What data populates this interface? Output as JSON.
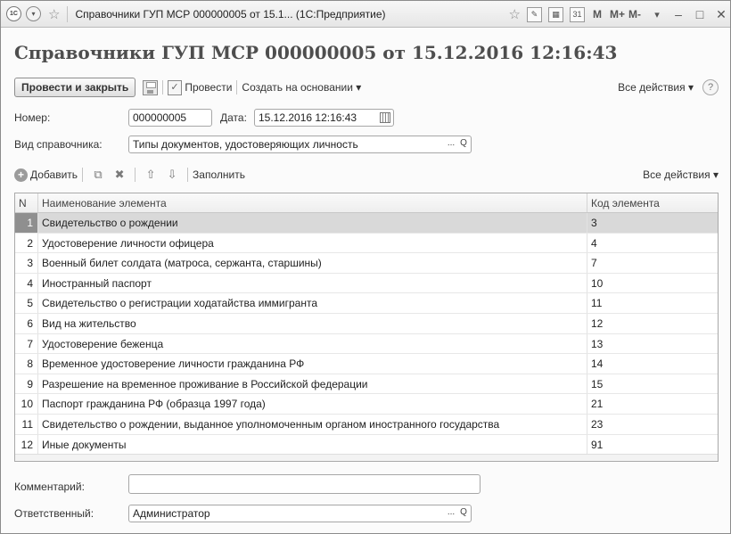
{
  "window": {
    "title": "Справочники ГУП МСР 000000005 от 15.1... (1С:Предприятие)",
    "logo_text": "1С",
    "title_right": {
      "m": "M",
      "m_plus": "M+",
      "m_minus": "M-"
    }
  },
  "doc": {
    "title": "Справочники ГУП МСР 000000005 от 15.12.2016 12:16:43"
  },
  "commands": {
    "post_close": "Провести и закрыть",
    "post": "Провести",
    "create_based": "Создать на основании ▾",
    "all_actions": "Все действия ▾",
    "help": "?"
  },
  "form": {
    "number_label": "Номер:",
    "number_value": "000000005",
    "date_label": "Дата:",
    "date_value": "15.12.2016 12:16:43",
    "kind_label": "Вид справочника:",
    "kind_value": "Типы документов, удостоверяющих личность",
    "comment_label": "Комментарий:",
    "comment_value": "",
    "responsible_label": "Ответственный:",
    "responsible_value": "Администратор",
    "select_btn": "...",
    "search_btn": "Q"
  },
  "table_toolbar": {
    "add": "Добавить",
    "fill": "Заполнить",
    "all_actions": "Все действия ▾"
  },
  "table": {
    "headers": {
      "n": "N",
      "name": "Наименование элемента",
      "code": "Код элемента"
    },
    "rows": [
      {
        "n": "1",
        "name": "Свидетельство о рождении",
        "code": "3"
      },
      {
        "n": "2",
        "name": "Удостоверение личности офицера",
        "code": "4"
      },
      {
        "n": "3",
        "name": "Военный билет солдата (матроса, сержанта, старшины)",
        "code": "7"
      },
      {
        "n": "4",
        "name": "Иностранный паспорт",
        "code": "10"
      },
      {
        "n": "5",
        "name": "Свидетельство о регистрации ходатайства иммигранта",
        "code": "11"
      },
      {
        "n": "6",
        "name": "Вид на жительство",
        "code": "12"
      },
      {
        "n": "7",
        "name": "Удостоверение беженца",
        "code": "13"
      },
      {
        "n": "8",
        "name": "Временное удостоверение личности гражданина РФ",
        "code": "14"
      },
      {
        "n": "9",
        "name": "Разрешение на временное проживание в Российской федерации",
        "code": "15"
      },
      {
        "n": "10",
        "name": "Паспорт гражданина РФ (образца 1997 года)",
        "code": "21"
      },
      {
        "n": "11",
        "name": "Свидетельство о рождении, выданное уполномоченным органом иностранного государства",
        "code": "23"
      },
      {
        "n": "12",
        "name": "Иные документы",
        "code": "91"
      }
    ],
    "selected_index": 0
  }
}
